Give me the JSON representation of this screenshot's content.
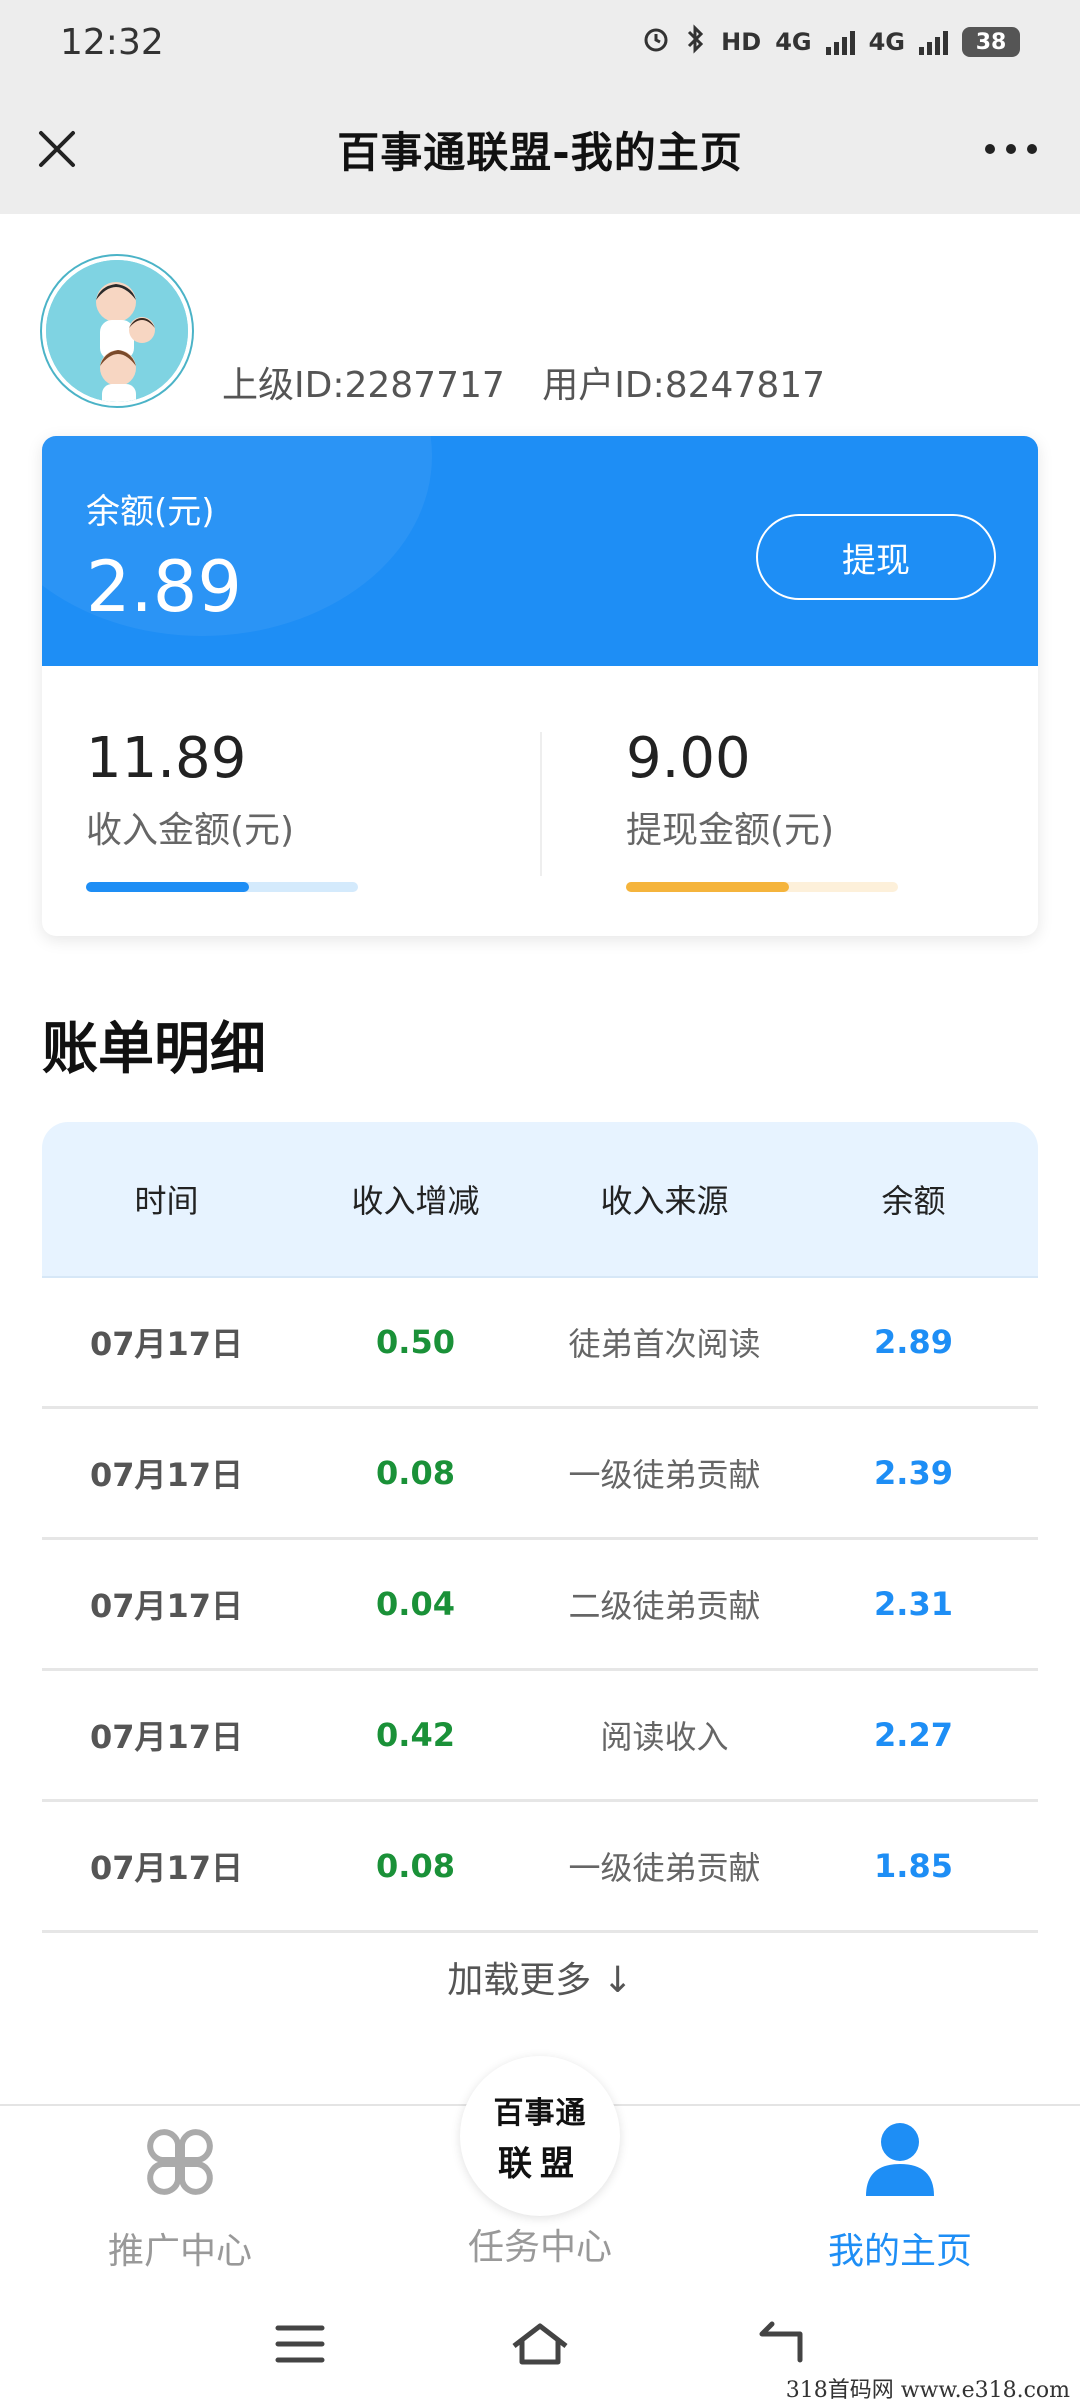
{
  "status_bar": {
    "time": "12:32",
    "hd_label": "HD",
    "net1": "4G",
    "net2": "4G",
    "battery": "38"
  },
  "header": {
    "title": "百事通联盟-我的主页"
  },
  "profile": {
    "parent_id": "上级ID:2287717",
    "user_id": "用户ID:8247817"
  },
  "balance": {
    "label": "余额(元)",
    "value": "2.89",
    "withdraw_button": "提现"
  },
  "stats": {
    "income": {
      "value": "11.89",
      "label": "收入金额(元)",
      "progress": 0.6
    },
    "withdrawn": {
      "value": "9.00",
      "label": "提现金额(元)",
      "progress": 0.6
    }
  },
  "colors": {
    "primary": "#1e8ef5",
    "income_bar": "#1e8ef5",
    "income_track": "#d4eafc",
    "withdraw_bar": "#f5b43c",
    "withdraw_track": "#fdf0da",
    "positive": "#1a9138"
  },
  "bill": {
    "title": "账单明细",
    "columns": [
      "时间",
      "收入增减",
      "收入来源",
      "余额"
    ],
    "rows": [
      {
        "date": "07月17日",
        "change": "0.50",
        "source": "徒弟首次阅读",
        "balance": "2.89"
      },
      {
        "date": "07月17日",
        "change": "0.08",
        "source": "一级徒弟贡献",
        "balance": "2.39"
      },
      {
        "date": "07月17日",
        "change": "0.04",
        "source": "二级徒弟贡献",
        "balance": "2.31"
      },
      {
        "date": "07月17日",
        "change": "0.42",
        "source": "阅读收入",
        "balance": "2.27"
      },
      {
        "date": "07月17日",
        "change": "0.08",
        "source": "一级徒弟贡献",
        "balance": "1.85"
      }
    ],
    "load_more": "加载更多 ↓"
  },
  "nav": {
    "promo": "推广中心",
    "task": "任务中心",
    "home": "我的主页",
    "logo_line1": "百事通",
    "logo_line2": "联盟",
    "icons": {
      "promo": "clover-grid-icon",
      "home": "user-icon"
    }
  },
  "watermark": "318首码网  www.e318.com"
}
